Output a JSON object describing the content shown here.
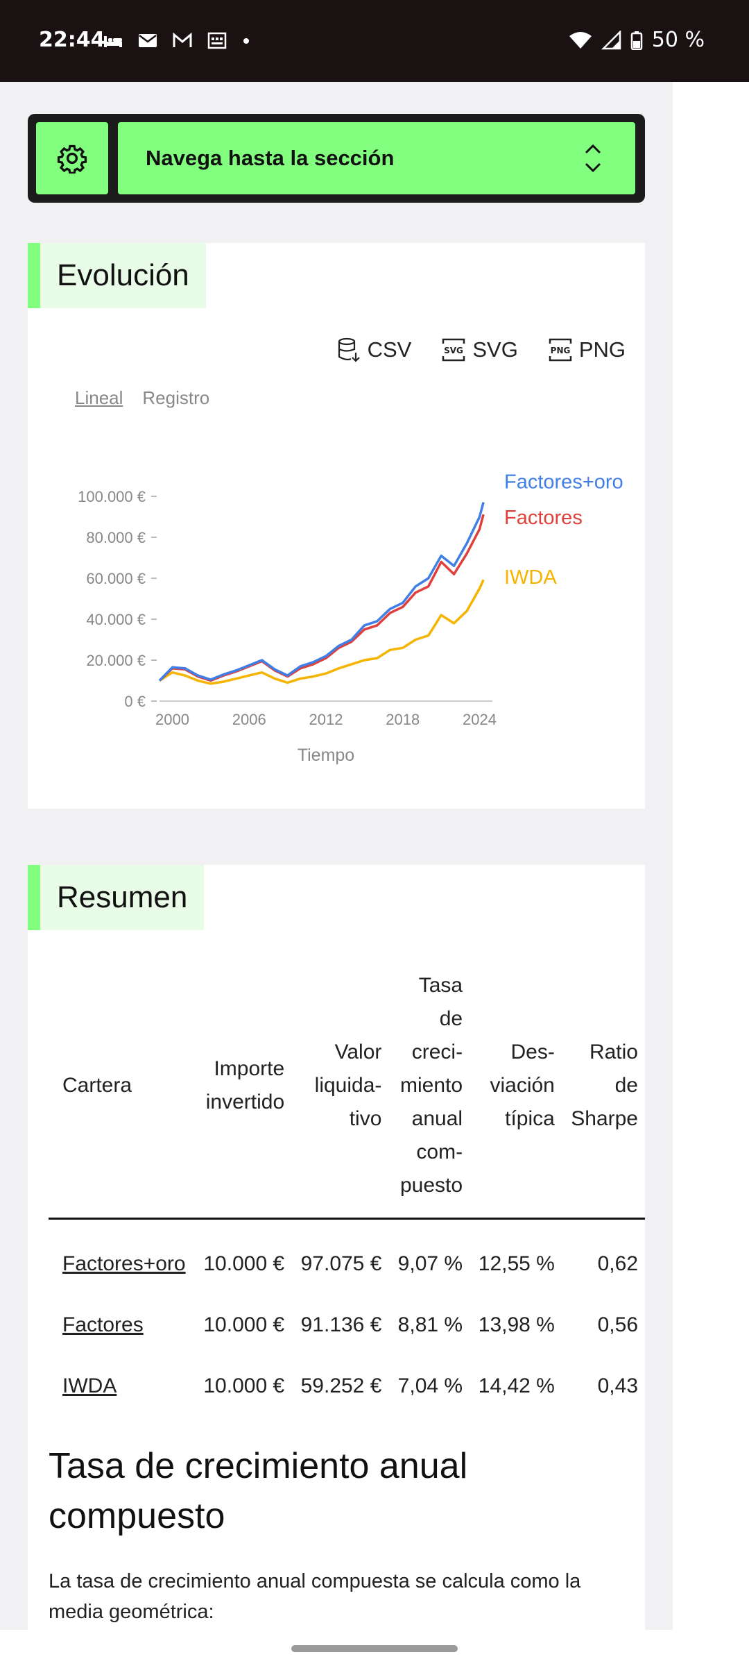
{
  "status_bar": {
    "time": "22:44",
    "battery": "50 %",
    "left_icons": [
      "bed-icon",
      "mail-icon",
      "gmail-icon",
      "calendar-icon",
      "dot-icon"
    ],
    "right_icons": [
      "wifi-icon",
      "signal-icon",
      "battery-icon"
    ]
  },
  "nav": {
    "settings_icon": "gear-icon",
    "select_label": "Navega hasta la sección",
    "accent": "#82ff7f"
  },
  "evolucion": {
    "title": "Evolución",
    "downloads": [
      "CSV",
      "SVG",
      "PNG"
    ],
    "scale_options": {
      "active": "Lineal",
      "inactive": "Registro"
    }
  },
  "chart_data": {
    "type": "line",
    "xlabel": "Tiempo",
    "ylabel": "",
    "x_ticks": [
      "2000",
      "2006",
      "2012",
      "2018",
      "2024"
    ],
    "y_ticks": [
      "0 €",
      "20.000 €",
      "40.000 €",
      "60.000 €",
      "80.000 €",
      "100.000 €"
    ],
    "xlim": [
      1999,
      2025
    ],
    "ylim": [
      0,
      100000
    ],
    "grid": false,
    "legend": "end-of-line labels",
    "series": [
      {
        "name": "IWDA",
        "color": "#f4b400",
        "points": [
          [
            1999,
            10000
          ],
          [
            2000,
            14000
          ],
          [
            2001,
            12500
          ],
          [
            2002,
            10000
          ],
          [
            2003,
            8500
          ],
          [
            2004,
            9500
          ],
          [
            2005,
            11000
          ],
          [
            2006,
            12500
          ],
          [
            2007,
            14000
          ],
          [
            2008,
            11000
          ],
          [
            2009,
            9000
          ],
          [
            2010,
            11000
          ],
          [
            2011,
            12000
          ],
          [
            2012,
            13500
          ],
          [
            2013,
            16000
          ],
          [
            2014,
            18000
          ],
          [
            2015,
            20000
          ],
          [
            2016,
            21000
          ],
          [
            2017,
            25000
          ],
          [
            2018,
            26000
          ],
          [
            2019,
            30000
          ],
          [
            2020,
            32000
          ],
          [
            2021,
            42000
          ],
          [
            2022,
            38000
          ],
          [
            2023,
            44000
          ],
          [
            2024,
            55000
          ],
          [
            2024.3,
            59252
          ]
        ]
      },
      {
        "name": "Factores",
        "color": "#e0403c",
        "points": [
          [
            1999,
            10000
          ],
          [
            2000,
            16000
          ],
          [
            2001,
            15500
          ],
          [
            2002,
            12000
          ],
          [
            2003,
            10000
          ],
          [
            2004,
            12500
          ],
          [
            2005,
            14500
          ],
          [
            2006,
            17000
          ],
          [
            2007,
            19500
          ],
          [
            2008,
            15000
          ],
          [
            2009,
            12000
          ],
          [
            2010,
            16000
          ],
          [
            2011,
            18000
          ],
          [
            2012,
            21000
          ],
          [
            2013,
            26000
          ],
          [
            2014,
            29000
          ],
          [
            2015,
            35000
          ],
          [
            2016,
            37000
          ],
          [
            2017,
            43000
          ],
          [
            2018,
            46000
          ],
          [
            2019,
            53000
          ],
          [
            2020,
            56000
          ],
          [
            2021,
            68000
          ],
          [
            2022,
            62000
          ],
          [
            2023,
            72000
          ],
          [
            2024,
            84000
          ],
          [
            2024.3,
            91136
          ]
        ]
      },
      {
        "name": "Factores+oro",
        "color": "#3f7fe6",
        "points": [
          [
            1999,
            10000
          ],
          [
            2000,
            16500
          ],
          [
            2001,
            16000
          ],
          [
            2002,
            12500
          ],
          [
            2003,
            10500
          ],
          [
            2004,
            13000
          ],
          [
            2005,
            15000
          ],
          [
            2006,
            17500
          ],
          [
            2007,
            20000
          ],
          [
            2008,
            15500
          ],
          [
            2009,
            12500
          ],
          [
            2010,
            17000
          ],
          [
            2011,
            19000
          ],
          [
            2012,
            22000
          ],
          [
            2013,
            27000
          ],
          [
            2014,
            30000
          ],
          [
            2015,
            37000
          ],
          [
            2016,
            39000
          ],
          [
            2017,
            45000
          ],
          [
            2018,
            48000
          ],
          [
            2019,
            56000
          ],
          [
            2020,
            60000
          ],
          [
            2021,
            71000
          ],
          [
            2022,
            66000
          ],
          [
            2023,
            77000
          ],
          [
            2024,
            90000
          ],
          [
            2024.3,
            97075
          ]
        ]
      }
    ]
  },
  "resumen": {
    "title": "Resumen",
    "headers": [
      [
        "Cartera"
      ],
      [
        "Importe",
        "invertido"
      ],
      [
        "Valor",
        "liquida-",
        "tivo"
      ],
      [
        "Tasa",
        "de",
        "creci-",
        "miento",
        "anual",
        "com-",
        "puesto"
      ],
      [
        "Des-",
        "viación",
        "típica"
      ],
      [
        "Ratio",
        "de",
        "Sharpe"
      ]
    ],
    "rows": [
      [
        "Factores+oro",
        "10.000 €",
        "97.075 €",
        "9,07 %",
        "12,55 %",
        "0,62"
      ],
      [
        "Factores",
        "10.000 €",
        "91.136 €",
        "8,81 %",
        "13,98 %",
        "0,56"
      ],
      [
        "IWDA",
        "10.000 €",
        "59.252 €",
        "7,04 %",
        "14,42 %",
        "0,43"
      ]
    ],
    "subheading": "Tasa de crecimiento anual compuesto",
    "paragraph": "La tasa de crecimiento anual compuesta se calcula como la media geométrica:"
  }
}
